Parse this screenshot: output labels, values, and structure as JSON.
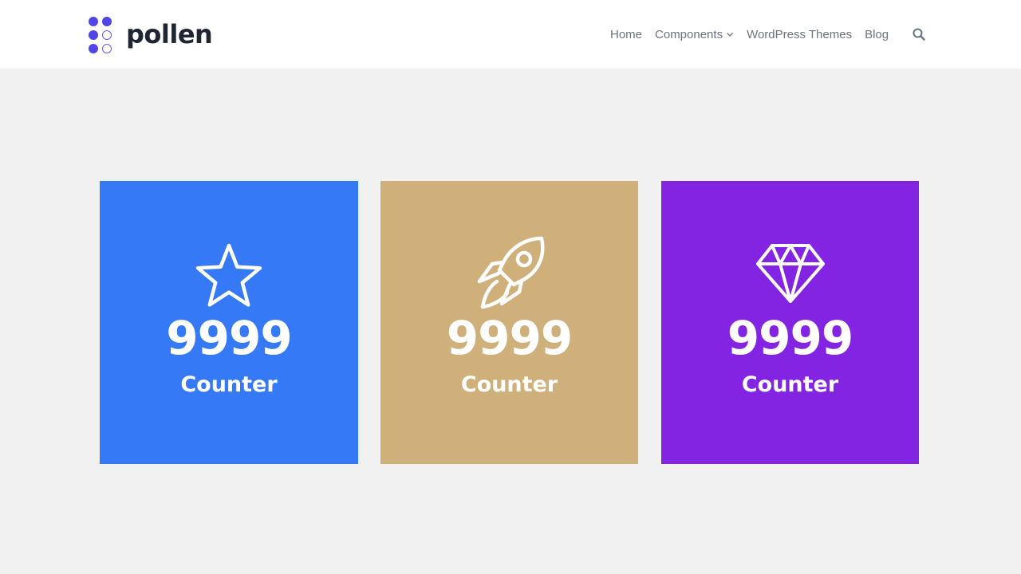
{
  "brand": {
    "name": "pollen",
    "color": "#4f46e5"
  },
  "nav": {
    "items": [
      {
        "label": "Home"
      },
      {
        "label": "Components",
        "has_dropdown": true
      },
      {
        "label": "WordPress Themes"
      },
      {
        "label": "Blog"
      }
    ],
    "search_icon": "search-icon"
  },
  "counters": [
    {
      "icon": "star-icon",
      "value": "9999",
      "label": "Counter",
      "color": "#3579f6"
    },
    {
      "icon": "rocket-icon",
      "value": "9999",
      "label": "Counter",
      "color": "#cfb07b"
    },
    {
      "icon": "diamond-icon",
      "value": "9999",
      "label": "Counter",
      "color": "#8424e3"
    }
  ]
}
